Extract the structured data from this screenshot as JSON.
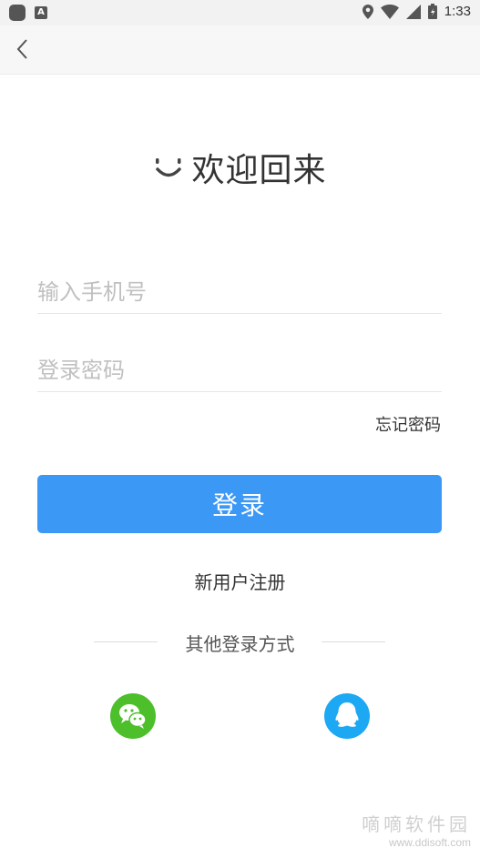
{
  "status_bar": {
    "time": "1:33",
    "icons": [
      "app-icon",
      "a-notification-icon",
      "location-icon",
      "wifi-icon",
      "signal-icon",
      "battery-icon"
    ],
    "a_glyph": "A"
  },
  "header": {
    "back_icon": "chevron-left-icon"
  },
  "welcome": {
    "icon": "smile-icon",
    "text": "欢迎回来"
  },
  "form": {
    "phone_placeholder": "输入手机号",
    "password_placeholder": "登录密码",
    "phone_value": "",
    "password_value": "",
    "forgot_label": "忘记密码",
    "login_label": "登录",
    "register_label": "新用户注册"
  },
  "other_login": {
    "label": "其他登录方式",
    "options": [
      {
        "name": "wechat",
        "icon": "wechat-icon",
        "color": "#4cbf2a"
      },
      {
        "name": "qq",
        "icon": "qq-icon",
        "color": "#1da8f3"
      }
    ]
  },
  "theme": {
    "accent": "#3b98f5"
  },
  "watermark": {
    "title": "嘀嘀软件园",
    "url": "www.ddisoft.com"
  }
}
